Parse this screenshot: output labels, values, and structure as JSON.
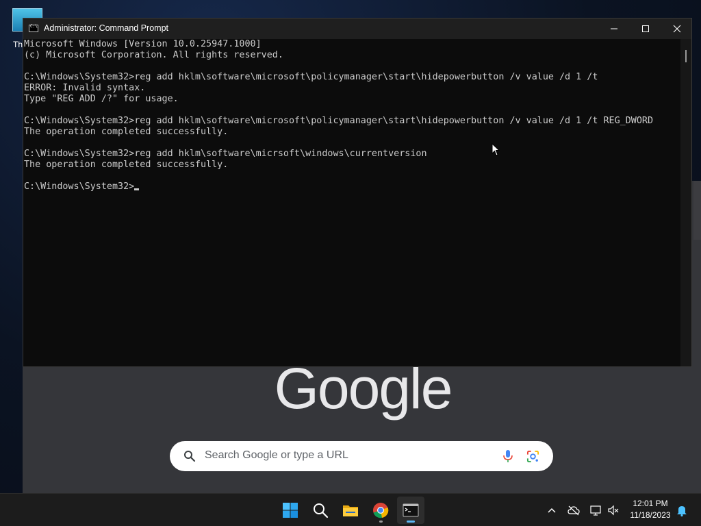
{
  "desktop": {
    "icon_label": "Th"
  },
  "browser": {
    "logo_text": "Google",
    "search_placeholder": "Search Google or type a URL"
  },
  "cmd": {
    "title": "Administrator: Command Prompt",
    "lines": [
      "Microsoft Windows [Version 10.0.25947.1000]",
      "(c) Microsoft Corporation. All rights reserved.",
      "",
      "C:\\Windows\\System32>reg add hklm\\software\\microsoft\\policymanager\\start\\hidepowerbutton /v value /d 1 /t",
      "ERROR: Invalid syntax.",
      "Type \"REG ADD /?\" for usage.",
      "",
      "C:\\Windows\\System32>reg add hklm\\software\\microsoft\\policymanager\\start\\hidepowerbutton /v value /d 1 /t REG_DWORD",
      "The operation completed successfully.",
      "",
      "C:\\Windows\\System32>reg add hklm\\software\\micrsoft\\windows\\currentversion",
      "The operation completed successfully.",
      "",
      "C:\\Windows\\System32>"
    ]
  },
  "taskbar": {
    "apps": [
      "start-icon",
      "search-icon",
      "file-explorer-icon",
      "chrome-icon",
      "terminal-icon"
    ],
    "tray": [
      "chevron-up-icon",
      "cloud-offline-icon",
      "network-icon",
      "volume-muted-icon"
    ],
    "time": "12:01 PM",
    "date": "11/18/2023"
  },
  "colors": {
    "console_bg": "#0c0c0c",
    "console_text": "#cccccc",
    "taskbar_bg": "#1c1c1c",
    "accent": "#5cb8f5"
  }
}
